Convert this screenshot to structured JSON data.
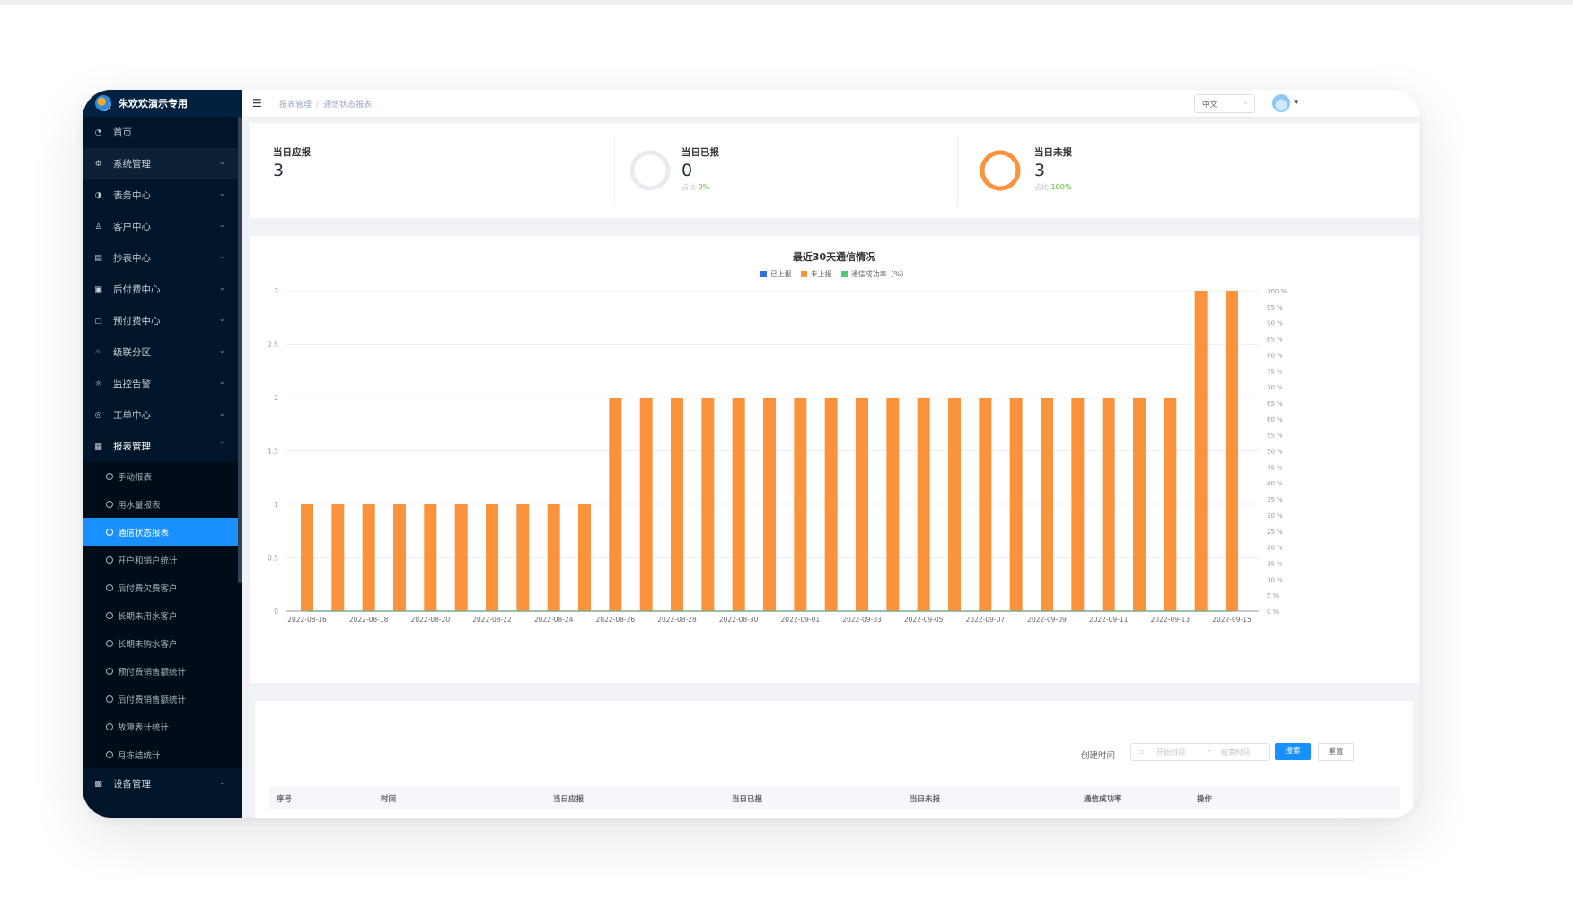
{
  "app": {
    "title": "朱欢欢演示专用"
  },
  "sidebar": {
    "items": [
      {
        "label": "首页",
        "icon": "dashboard-icon",
        "glyph": "◔",
        "arrow": ""
      },
      {
        "label": "系统管理",
        "icon": "settings-icon",
        "glyph": "⚙",
        "arrow": "⌄"
      },
      {
        "label": "表务中心",
        "icon": "gauge-icon",
        "glyph": "◑",
        "arrow": "⌄"
      },
      {
        "label": "客户中心",
        "icon": "user-icon",
        "glyph": "♙",
        "arrow": "⌄"
      },
      {
        "label": "抄表中心",
        "icon": "meter-reading-icon",
        "glyph": "▤",
        "arrow": "⌄"
      },
      {
        "label": "后付费中心",
        "icon": "wallet-icon",
        "glyph": "▣",
        "arrow": "⌄"
      },
      {
        "label": "预付费中心",
        "icon": "card-icon",
        "glyph": "▢",
        "arrow": "⌄"
      },
      {
        "label": "级联分区",
        "icon": "users-icon",
        "glyph": "♨",
        "arrow": "⌄"
      },
      {
        "label": "监控告警",
        "icon": "alarm-icon",
        "glyph": "☼",
        "arrow": "⌄"
      },
      {
        "label": "工单中心",
        "icon": "ticket-icon",
        "glyph": "◎",
        "arrow": "⌄"
      },
      {
        "label": "报表管理",
        "icon": "report-icon",
        "glyph": "▦",
        "arrow": "⌃"
      }
    ],
    "report_sub_items": [
      "手动报表",
      "用水量报表",
      "通信状态报表",
      "开户和销户统计",
      "后付费欠费客户",
      "长期未用水客户",
      "长期未购水客户",
      "预付费销售额统计",
      "后付费销售额统计",
      "故障表计统计",
      "月冻结统计"
    ],
    "bottom_item": {
      "label": "设备管理",
      "icon": "device-icon",
      "glyph": "▩",
      "arrow": "⌄"
    }
  },
  "header": {
    "breadcrumb": [
      "报表管理",
      "通信状态报表"
    ],
    "breadcrumb_sep": "/",
    "language": "中文"
  },
  "stats": [
    {
      "label": "当日应报",
      "value": "3"
    },
    {
      "label": "当日已报",
      "value": "0",
      "ratio_label": "占比",
      "ratio": "0%",
      "fraction": 0
    },
    {
      "label": "当日未报",
      "value": "3",
      "ratio_label": "占比",
      "ratio": "100%",
      "fraction": 1
    }
  ],
  "chart_data": {
    "type": "bar",
    "title": "最近30天通信情况",
    "categories": [
      "2022-08-16",
      "2022-08-17",
      "2022-08-18",
      "2022-08-19",
      "2022-08-20",
      "2022-08-21",
      "2022-08-22",
      "2022-08-23",
      "2022-08-24",
      "2022-08-25",
      "2022-08-26",
      "2022-08-27",
      "2022-08-28",
      "2022-08-29",
      "2022-08-30",
      "2022-08-31",
      "2022-09-01",
      "2022-09-02",
      "2022-09-03",
      "2022-09-04",
      "2022-09-05",
      "2022-09-06",
      "2022-09-07",
      "2022-09-08",
      "2022-09-09",
      "2022-09-10",
      "2022-09-11",
      "2022-09-12",
      "2022-09-13",
      "2022-09-14",
      "2022-09-15"
    ],
    "tick_labels": [
      "2022-08-16",
      "2022-08-18",
      "2022-08-20",
      "2022-08-22",
      "2022-08-24",
      "2022-08-26",
      "2022-08-28",
      "2022-08-30",
      "2022-09-01",
      "2022-09-03",
      "2022-09-05",
      "2022-09-07",
      "2022-09-09",
      "2022-09-11",
      "2022-09-13",
      "2022-09-15"
    ],
    "series": [
      {
        "name": "已上报",
        "color": "#2f6fe0",
        "values": [
          0,
          0,
          0,
          0,
          0,
          0,
          0,
          0,
          0,
          0,
          0,
          0,
          0,
          0,
          0,
          0,
          0,
          0,
          0,
          0,
          0,
          0,
          0,
          0,
          0,
          0,
          0,
          0,
          0,
          0,
          0
        ]
      },
      {
        "name": "未上报",
        "color": "#fb923c",
        "values": [
          1,
          1,
          1,
          1,
          1,
          1,
          1,
          1,
          1,
          1,
          2,
          2,
          2,
          2,
          2,
          2,
          2,
          2,
          2,
          2,
          2,
          2,
          2,
          2,
          2,
          2,
          2,
          2,
          2,
          3,
          3
        ]
      },
      {
        "name": "通信成功率（%）",
        "color": "#4ecb73",
        "axis": "right",
        "values": [
          0,
          0,
          0,
          0,
          0,
          0,
          0,
          0,
          0,
          0,
          0,
          0,
          0,
          0,
          0,
          0,
          0,
          0,
          0,
          0,
          0,
          0,
          0,
          0,
          0,
          0,
          0,
          0,
          0,
          0,
          0
        ]
      }
    ],
    "ylim": [
      0,
      3
    ],
    "y_ticks": [
      "0",
      "0.5",
      "1",
      "1.5",
      "2",
      "2.5",
      "3"
    ],
    "y2lim": [
      0,
      100
    ],
    "y2_ticks": [
      "0 %",
      "5 %",
      "10 %",
      "15 %",
      "20 %",
      "25 %",
      "30 %",
      "35 %",
      "40 %",
      "45 %",
      "50 %",
      "55 %",
      "60 %",
      "65 %",
      "70 %",
      "75 %",
      "80 %",
      "85 %",
      "90 %",
      "95 %",
      "100 %"
    ],
    "legend_position": "top-center",
    "grid": true
  },
  "filter": {
    "label": "创建时间",
    "start_placeholder": "开始时间",
    "range_separator": "-",
    "end_placeholder": "结束时间",
    "search_label": "搜索",
    "reset_label": "重置"
  },
  "table": {
    "columns": [
      "序号",
      "时间",
      "当日应报",
      "当日已报",
      "当日未报",
      "通信成功率",
      "操作"
    ]
  },
  "colors": {
    "sidebar": "#001529",
    "accent": "#1890ff",
    "bar": "#fb923c",
    "success": "#52c41a"
  }
}
